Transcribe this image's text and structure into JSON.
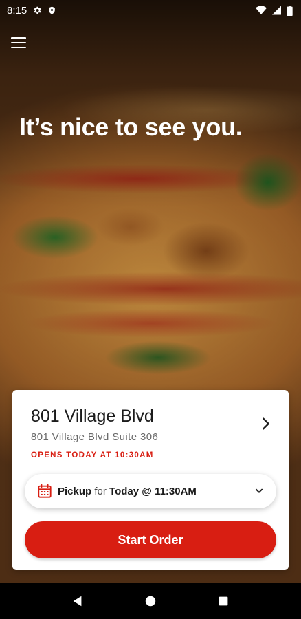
{
  "status_bar": {
    "time": "8:15",
    "icons_left": [
      "gear-icon",
      "shield-icon"
    ],
    "icons_right": [
      "wifi-icon",
      "signal-icon",
      "battery-icon"
    ]
  },
  "header": {
    "menu_icon": "hamburger-menu-icon"
  },
  "hero": {
    "greeting": "It’s nice to see you."
  },
  "location": {
    "name": "801 Village Blvd",
    "address": "801 Village Blvd Suite 306",
    "hours_status": "OPENS TODAY AT 10:30AM"
  },
  "order_options": {
    "mode": "Pickup",
    "connector": "for",
    "time": "Today @ 11:30AM"
  },
  "actions": {
    "start_order": "Start Order"
  },
  "colors": {
    "accent": "#d81e12"
  }
}
